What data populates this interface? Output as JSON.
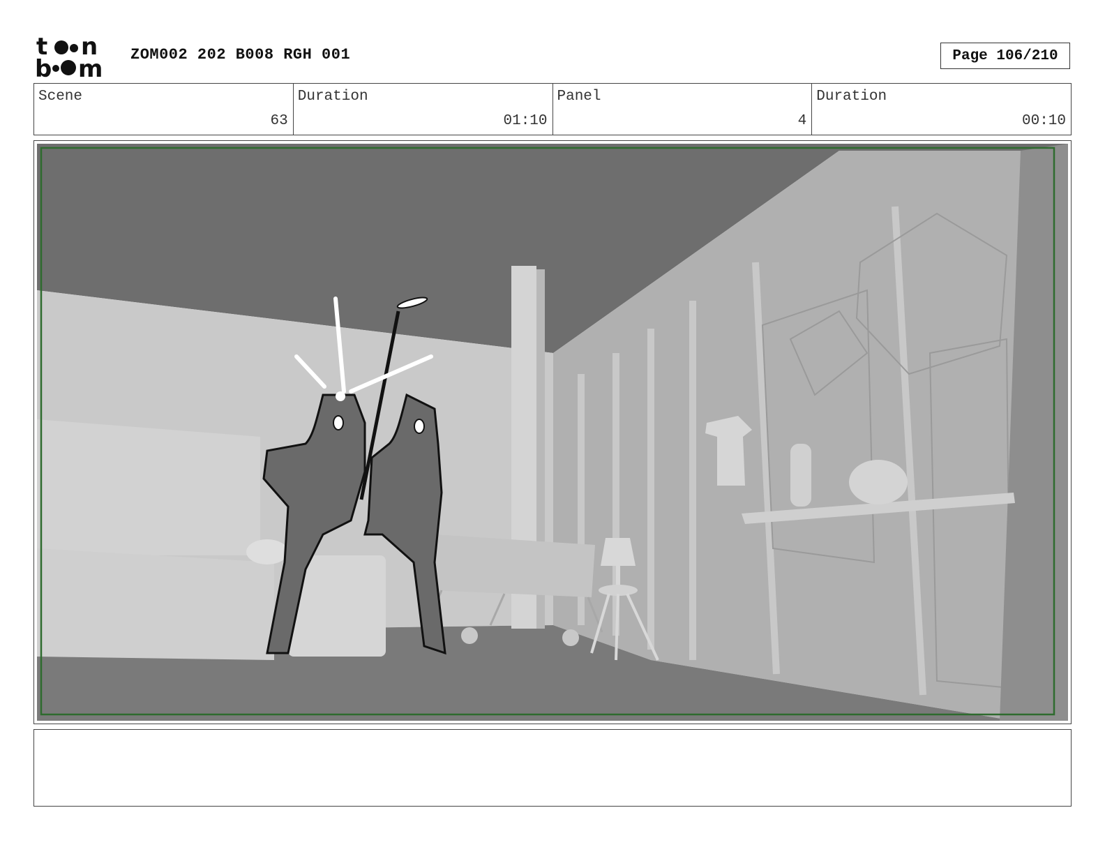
{
  "header": {
    "logo_text": "toon boom",
    "project_id": "ZOM002 202 B008 RGH 001",
    "page_label": "Page 106/210"
  },
  "info": {
    "scene_label": "Scene",
    "scene_value": "63",
    "scene_duration_label": "Duration",
    "scene_duration_value": "01:10",
    "panel_label": "Panel",
    "panel_value": "4",
    "panel_duration_label": "Duration",
    "panel_duration_value": "00:10"
  },
  "panel": {
    "frame_color": "#2e6b2e"
  },
  "notes": {
    "text": ""
  }
}
